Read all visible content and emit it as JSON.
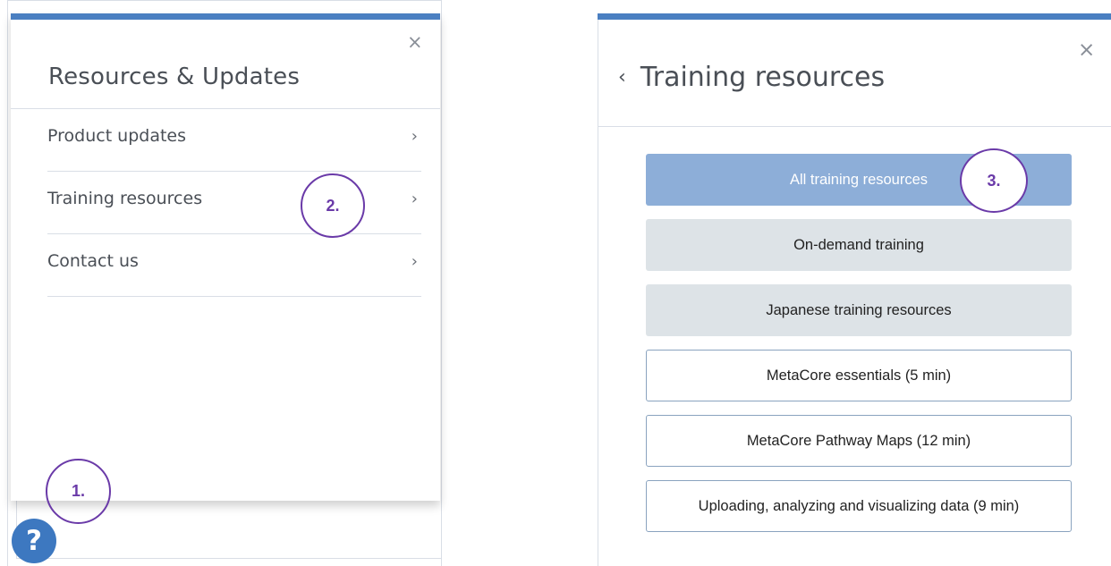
{
  "left_panel": {
    "title": "Resources & Updates",
    "close_glyph": "×",
    "menu_items": [
      {
        "label": "Product updates",
        "chevron": "›"
      },
      {
        "label": "Training resources",
        "chevron": "›"
      },
      {
        "label": "Contact us",
        "chevron": "›"
      }
    ]
  },
  "help_button": {
    "glyph": "?"
  },
  "right_panel": {
    "back_glyph": "‹",
    "title": "Training resources",
    "close_glyph": "×",
    "buttons": [
      {
        "label": "All training resources",
        "style": "primary"
      },
      {
        "label": "On-demand training",
        "style": "grey"
      },
      {
        "label": "Japanese training resources",
        "style": "grey"
      },
      {
        "label": "MetaCore essentials (5 min)",
        "style": "outline"
      },
      {
        "label": "MetaCore Pathway Maps (12 min)",
        "style": "outline"
      },
      {
        "label": "Uploading, analyzing and visualizing data (9 min)",
        "style": "outline"
      }
    ]
  },
  "step_badges": {
    "step1": "1.",
    "step2": "2.",
    "step3": "3."
  },
  "colors": {
    "accent_bar": "#4a7fc1",
    "primary_button": "#8daed8",
    "grey_button": "#dde3e7",
    "step_badge": "#6a3aa8",
    "help_button": "#3d78c0"
  }
}
